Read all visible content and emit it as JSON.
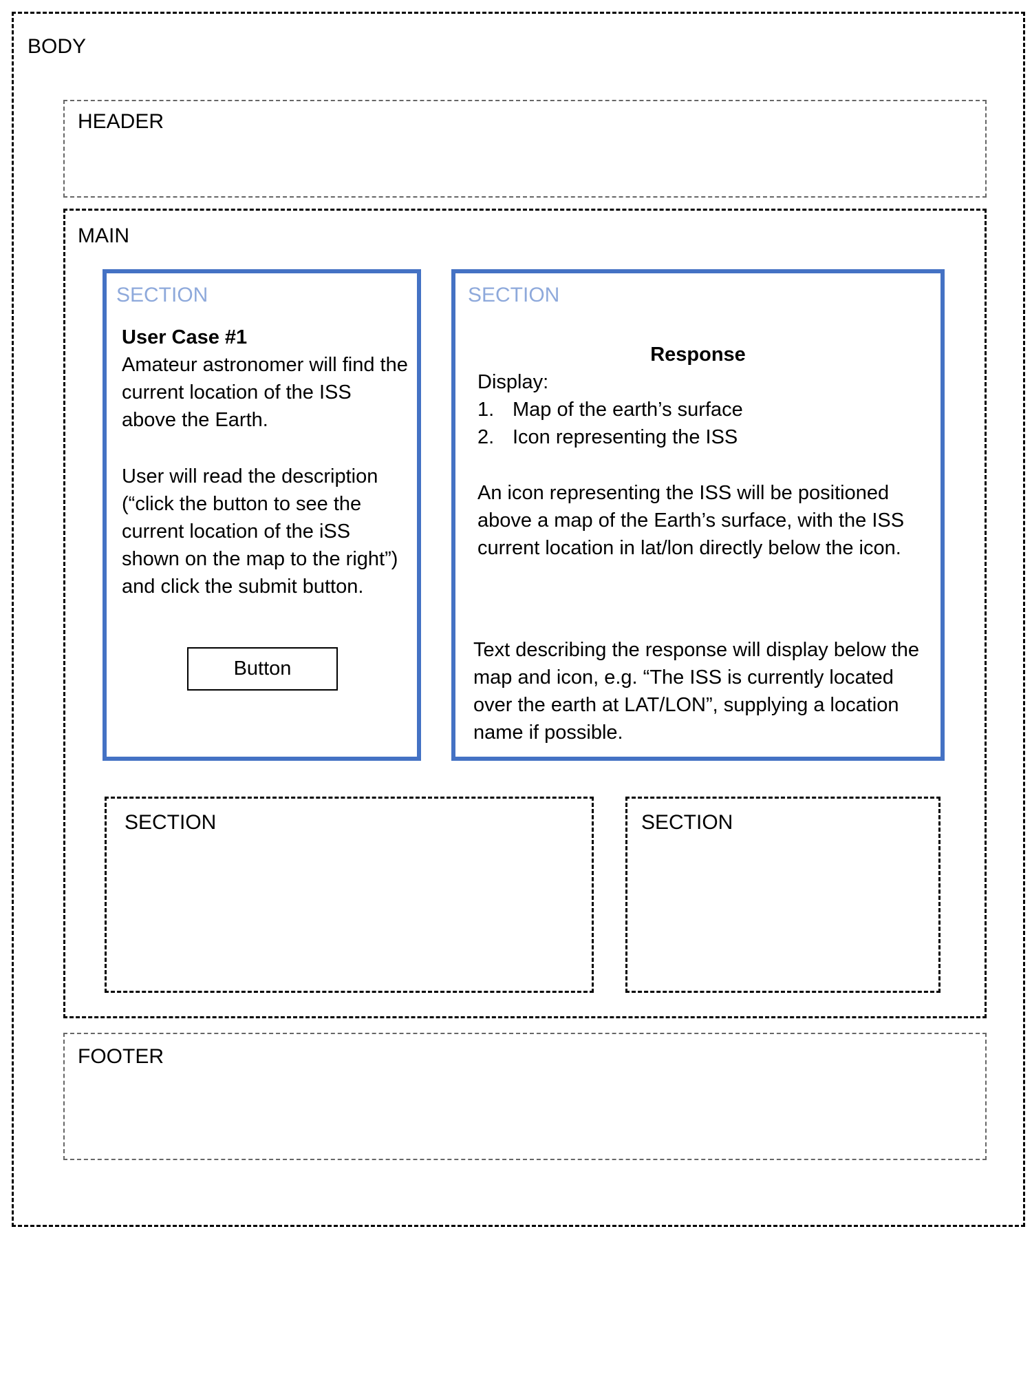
{
  "body": {
    "label": "BODY"
  },
  "header": {
    "label": "HEADER"
  },
  "main": {
    "label": "MAIN"
  },
  "section_left": {
    "label": "SECTION",
    "title": "User Case #1",
    "paragraph1": "Amateur astronomer will find the current location of the ISS above the Earth.",
    "paragraph2": "User will read the description (“click the button to see the current location of the iSS shown on the map to the right”) and click the submit button.",
    "button_label": "Button"
  },
  "section_right": {
    "label": "SECTION",
    "title": "Response",
    "display_label": "Display:",
    "list": [
      {
        "num": "1.",
        "text": "Map of the earth’s surface"
      },
      {
        "num": "2.",
        "text": "Icon representing the ISS"
      }
    ],
    "paragraph1": "An icon representing the ISS will be positioned above a map of the Earth’s surface, with the ISS current location in lat/lon directly below the icon.",
    "paragraph2": "Text describing the response will display below the map and icon, e.g. “The ISS is currently located over the earth at LAT/LON”, supplying a location name if possible."
  },
  "section_bottom_left": {
    "label": "SECTION"
  },
  "section_bottom_right": {
    "label": "SECTION"
  },
  "footer": {
    "label": "FOOTER"
  },
  "colors": {
    "section_border": "#4472C4",
    "section_label": "#8EA9DB"
  }
}
